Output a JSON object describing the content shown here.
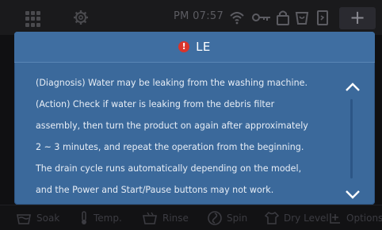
{
  "status_bar": {
    "time": "PM 07:57",
    "add_label": "+",
    "icons": [
      "grid-icon",
      "gear-icon",
      "wifi-icon",
      "key-icon",
      "lock-icon",
      "drum-icon",
      "door-icon"
    ]
  },
  "dialog": {
    "alert_glyph": "!",
    "title": "LE",
    "lines": [
      "(Diagnosis) Water may be leaking from the washing machine.",
      "(Action) Check if water is leaking from the debris filter",
      "assembly, then turn the product on again after approximately",
      "2 ~ 3 minutes, and repeat the operation from the beginning.",
      "The drain cycle runs automatically depending on the model,",
      "and the Power and Start/Pause buttons may not work."
    ]
  },
  "options": {
    "soak": "Soak",
    "temp": "Temp.",
    "rinse": "Rinse",
    "spin": "Spin",
    "dry_level": "Dry Level",
    "options": "Options"
  },
  "colors": {
    "dialog_bg": "#3b699b",
    "alert": "#d9342b",
    "dim_text": "#3c3c42"
  }
}
